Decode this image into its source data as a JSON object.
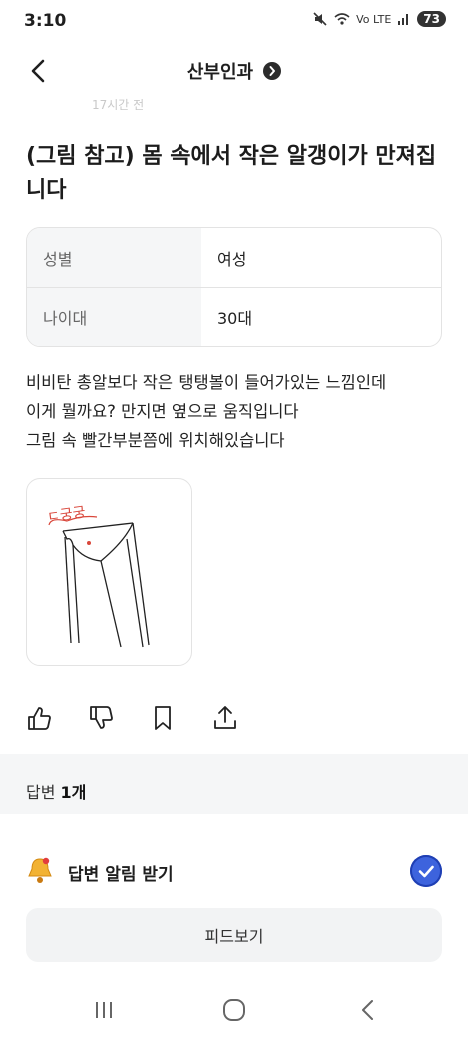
{
  "status_bar": {
    "time": "3:10",
    "network_label": "Vo LTE",
    "battery": "73"
  },
  "header": {
    "title": "산부인과"
  },
  "post": {
    "meta_partial": "17시간 전",
    "title": "(그림 참고) 몸 속에서 작은 알갱이가 만져집니다",
    "info": [
      {
        "label": "성별",
        "value": "여성"
      },
      {
        "label": "나이대",
        "value": "30대"
      }
    ],
    "body_lines": [
      "비비탄 총알보다 작은 탱탱볼이 들어가있는 느낌인데",
      "이게 뭘까요? 만지면 옆으로 움직입니다",
      "그림 속 빨간부분쯤에 위치해있습니다"
    ],
    "drawing_caption": "ㄷ궁궁"
  },
  "answers": {
    "label": "답변",
    "count": "1개"
  },
  "alert": {
    "label": "답변 알림 받기",
    "enabled": true
  },
  "feed_button": "피드보기",
  "colors": {
    "accent": "#3d63dd",
    "table_label_bg": "#f5f6f7",
    "drawing_red": "#d9473b"
  },
  "icons": [
    "back-icon",
    "chevron-right-icon",
    "thumbs-up-icon",
    "thumbs-down-icon",
    "bookmark-icon",
    "share-icon",
    "bell-icon",
    "check-icon",
    "recents-icon",
    "home-icon",
    "nav-back-icon"
  ]
}
